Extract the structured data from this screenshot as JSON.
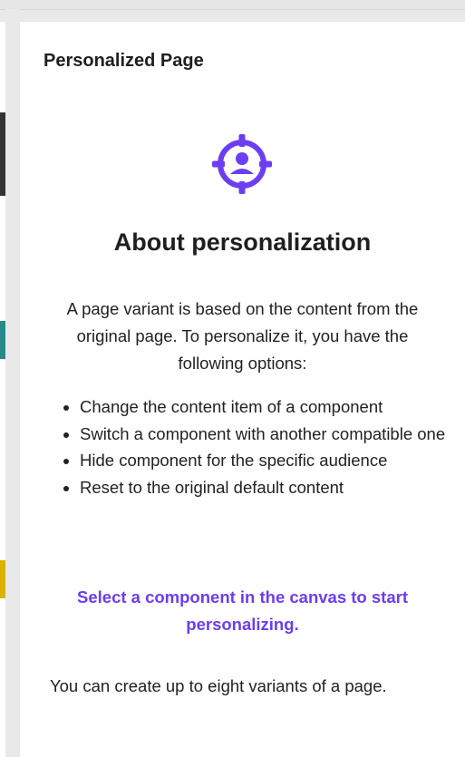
{
  "panel": {
    "title": "Personalized Page"
  },
  "about": {
    "icon": "target-person-icon",
    "heading": "About personalization",
    "intro": "A page variant is based on the content from the original page. To personalize it, you have the following options:",
    "options": [
      "Change the content item of a component",
      "Switch a component with another compatible one",
      "Hide component for the specific audience",
      "Reset to the original default content"
    ],
    "cta": "Select a component in the canvas to start personalizing.",
    "note": "You can create up to eight variants of a page."
  },
  "colors": {
    "accent": "#6b3ef2",
    "left_strip_segments": [
      "#333333",
      "#2a8a8a",
      "#d9b300"
    ]
  }
}
